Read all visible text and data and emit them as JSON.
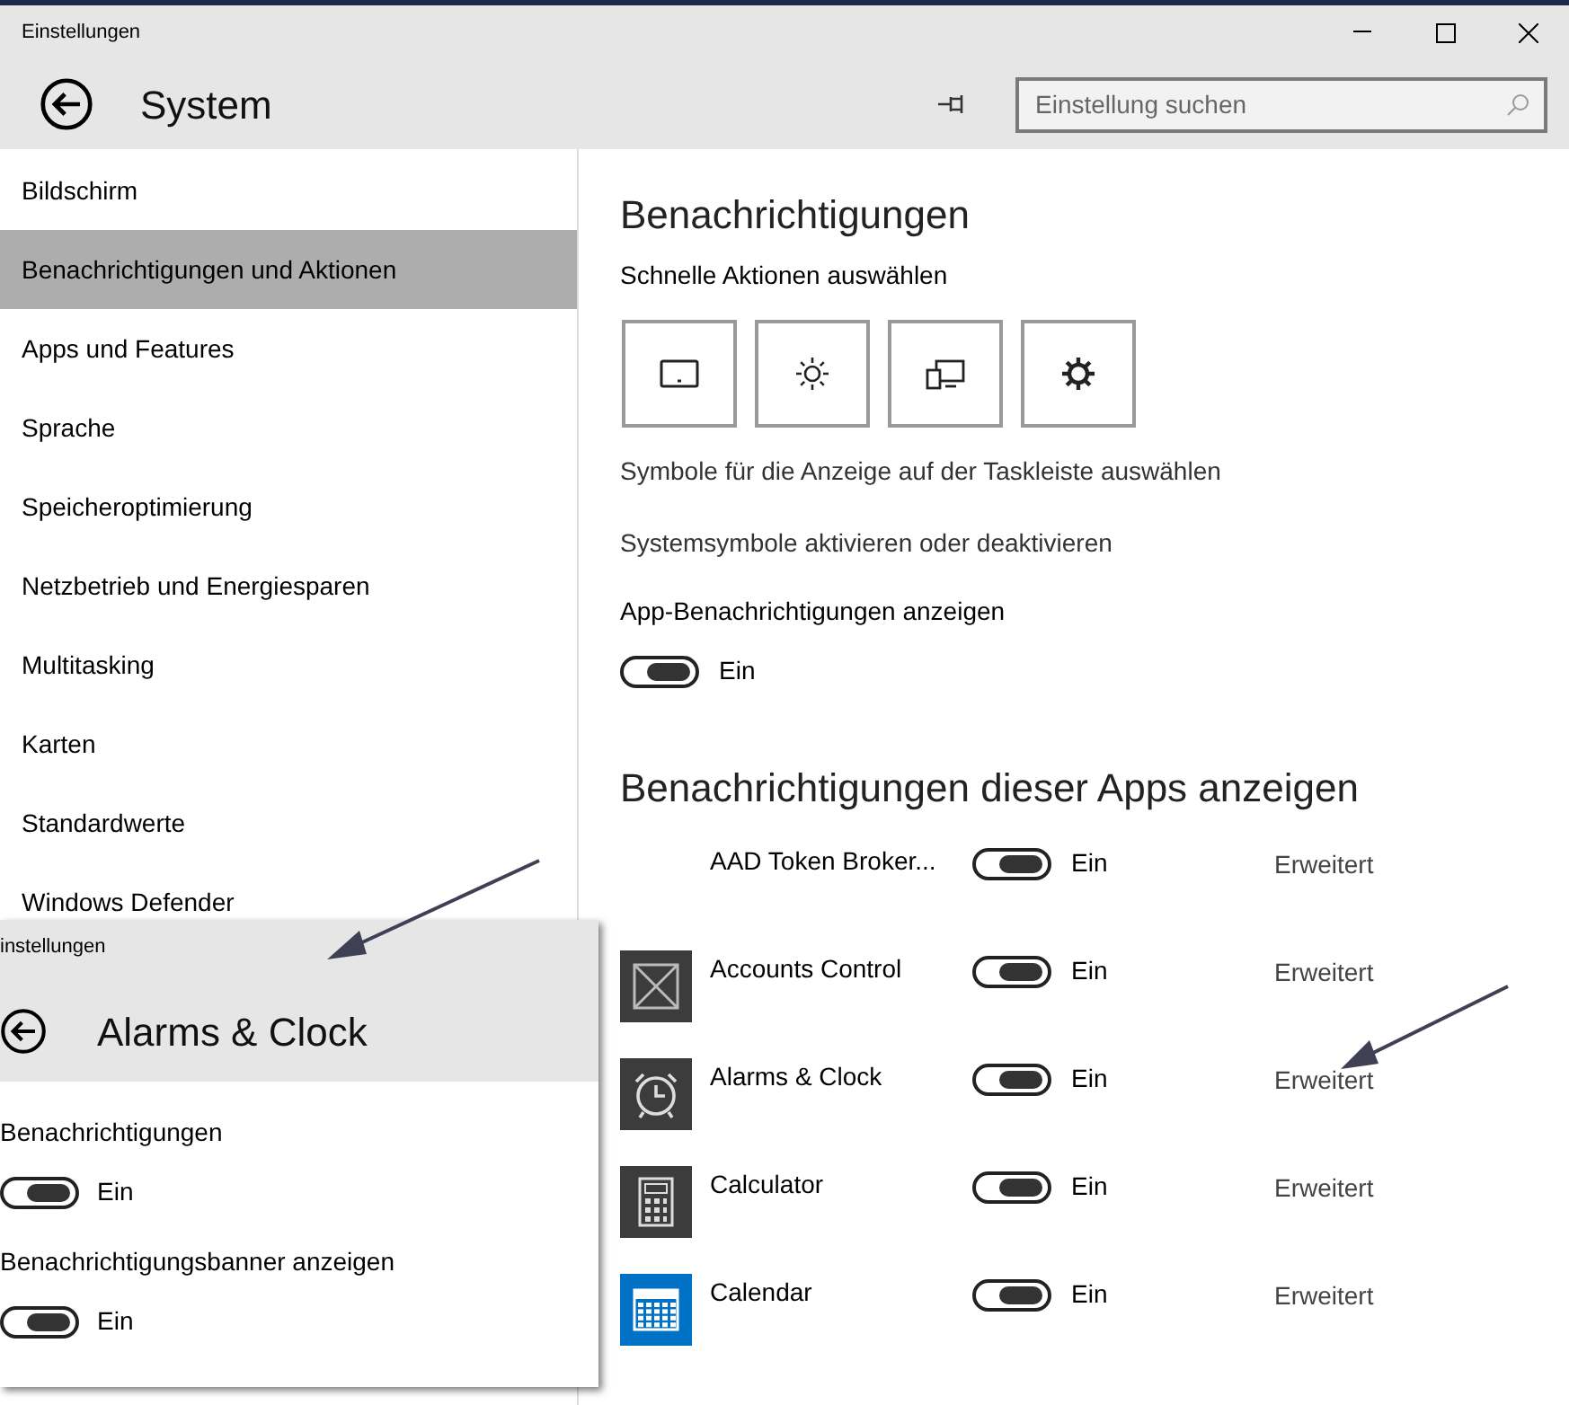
{
  "window": {
    "title": "Einstellungen",
    "page_title": "System"
  },
  "search": {
    "placeholder": "Einstellung suchen"
  },
  "sidebar": {
    "items": [
      {
        "label": "Bildschirm",
        "selected": false
      },
      {
        "label": "Benachrichtigungen und Aktionen",
        "selected": true
      },
      {
        "label": "Apps und Features",
        "selected": false
      },
      {
        "label": "Sprache",
        "selected": false
      },
      {
        "label": "Speicheroptimierung",
        "selected": false
      },
      {
        "label": "Netzbetrieb und Energiesparen",
        "selected": false
      },
      {
        "label": "Multitasking",
        "selected": false
      },
      {
        "label": "Karten",
        "selected": false
      },
      {
        "label": "Standardwerte",
        "selected": false
      },
      {
        "label": "Windows Defender",
        "selected": false
      }
    ]
  },
  "content": {
    "heading": "Benachrichtigungen",
    "quick_actions_label": "Schnelle Aktionen auswählen",
    "quick_actions": [
      {
        "kind": "tablet"
      },
      {
        "kind": "brightness"
      },
      {
        "kind": "project"
      },
      {
        "kind": "settings"
      }
    ],
    "links": [
      "Symbole für die Anzeige auf der Taskleiste auswählen",
      "Systemsymbole aktivieren oder deaktivieren"
    ],
    "app_notifications": {
      "label": "App-Benachrichtigungen anzeigen",
      "on": true,
      "state": "Ein"
    },
    "apps_heading": "Benachrichtigungen dieser Apps anzeigen",
    "apps": [
      {
        "name": "AAD Token Broker...",
        "kind": "none",
        "on": true,
        "state": "Ein",
        "link": "Erweitert"
      },
      {
        "name": "Accounts Control",
        "kind": "cross",
        "on": true,
        "state": "Ein",
        "link": "Erweitert"
      },
      {
        "name": "Alarms & Clock",
        "kind": "alarm",
        "on": true,
        "state": "Ein",
        "link": "Erweitert"
      },
      {
        "name": "Calculator",
        "kind": "calculator",
        "on": true,
        "state": "Ein",
        "link": "Erweitert"
      },
      {
        "name": "Calendar",
        "kind": "calendar",
        "on": true,
        "state": "Ein",
        "link": "Erweitert"
      }
    ]
  },
  "inset_window": {
    "title": "instellungen",
    "page_title": "Alarms & Clock",
    "settings": [
      {
        "label": "Benachrichtigungen",
        "on": true,
        "state": "Ein"
      },
      {
        "label": "Benachrichtigungsbanner anzeigen",
        "on": true,
        "state": "Ein"
      }
    ]
  }
}
